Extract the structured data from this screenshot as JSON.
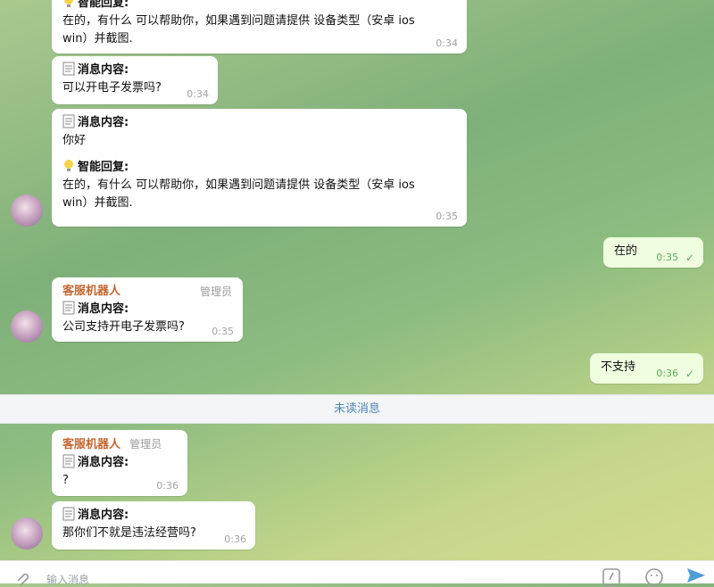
{
  "labels": {
    "content": "消息内容:",
    "reply": "智能回复:"
  },
  "sender": {
    "name": "客服机器人",
    "role": "管理员"
  },
  "messages": [
    {
      "reply_text_1": "在的，有什么 可以帮助你，如果遇到问题请提供 设备类型（安卓 ios",
      "reply_text_2": "win）并截图.",
      "time": "0:34"
    },
    {
      "content_text": "可以开电子发票吗?",
      "time": "0:34"
    },
    {
      "content_text": "你好",
      "reply_text_1": "在的，有什么 可以帮助你，如果遇到问题请提供 设备类型（安卓 ios",
      "reply_text_2": "win）并截图.",
      "time": "0:35"
    },
    {
      "text": "在的",
      "time": "0:35"
    },
    {
      "content_text": "公司支持开电子发票吗?",
      "time": "0:35"
    },
    {
      "text": "不支持",
      "time": "0:36"
    },
    {
      "content_text": "?",
      "time": "0:36"
    },
    {
      "content_text": "那你们不就是违法经营吗?",
      "time": "0:36"
    }
  ],
  "unread_divider": "未读消息",
  "composer": {
    "placeholder": "输入消息"
  },
  "icons": [
    "attach-icon",
    "bot-commands-icon",
    "emoji-icon",
    "send-icon",
    "check-icon",
    "memo-icon",
    "lightbulb-icon"
  ],
  "colors": {
    "sender_name": "#c4642f",
    "unread_text": "#4f86b5",
    "outgoing_bubble": "#eefedf",
    "check": "#5faa5c"
  }
}
